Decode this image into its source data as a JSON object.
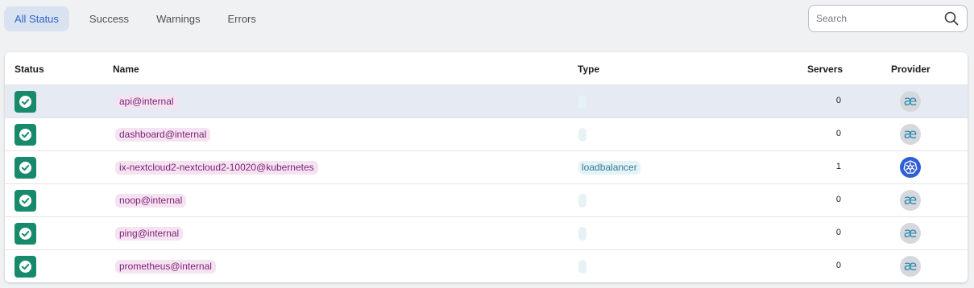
{
  "filters": {
    "tabs": [
      {
        "label": "All Status",
        "active": true
      },
      {
        "label": "Success",
        "active": false
      },
      {
        "label": "Warnings",
        "active": false
      },
      {
        "label": "Errors",
        "active": false
      }
    ]
  },
  "search": {
    "placeholder": "Search",
    "value": "",
    "icon": "magnifier-icon"
  },
  "table": {
    "headers": {
      "status": "Status",
      "name": "Name",
      "type": "Type",
      "servers": "Servers",
      "provider": "Provider"
    },
    "rows": [
      {
        "status": "success",
        "name": "api@internal",
        "type": "",
        "servers": "0",
        "provider": "internal",
        "selected": true
      },
      {
        "status": "success",
        "name": "dashboard@internal",
        "type": "",
        "servers": "0",
        "provider": "internal",
        "selected": false
      },
      {
        "status": "success",
        "name": "ix-nextcloud2-nextcloud2-10020@kubernetes",
        "type": "loadbalancer",
        "servers": "1",
        "provider": "kubernetes",
        "selected": false
      },
      {
        "status": "success",
        "name": "noop@internal",
        "type": "",
        "servers": "0",
        "provider": "internal",
        "selected": false
      },
      {
        "status": "success",
        "name": "ping@internal",
        "type": "",
        "servers": "0",
        "provider": "internal",
        "selected": false
      },
      {
        "status": "success",
        "name": "prometheus@internal",
        "type": "",
        "servers": "0",
        "provider": "internal",
        "selected": false
      }
    ]
  },
  "colors": {
    "success": "#178a6c",
    "name_chip_bg": "#f6e3f2",
    "name_chip_text": "#7a1f74",
    "type_chip_bg": "#e5f2f6",
    "type_chip_text": "#2f7d95",
    "kubernetes": "#2f5ed6"
  }
}
